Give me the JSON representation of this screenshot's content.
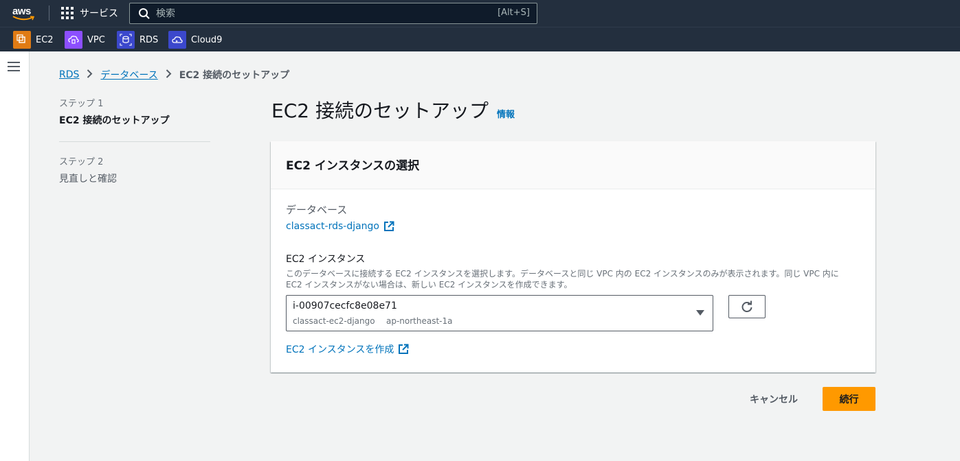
{
  "topbar": {
    "logo_text": "aws",
    "services_label": "サービス",
    "search": {
      "placeholder": "検索",
      "shortcut": "[Alt+S]"
    }
  },
  "favorites": [
    {
      "label": "EC2",
      "icon": "ec2-icon",
      "color": "#e07b14"
    },
    {
      "label": "VPC",
      "icon": "vpc-icon",
      "color": "#8c4fff"
    },
    {
      "label": "RDS",
      "icon": "rds-icon",
      "color": "#3b48cc"
    },
    {
      "label": "Cloud9",
      "icon": "cloud9-icon",
      "color": "#3b48cc"
    }
  ],
  "breadcrumb": {
    "items": [
      "RDS",
      "データベース"
    ],
    "current": "EC2 接続のセットアップ"
  },
  "steps": [
    {
      "number": "ステップ 1",
      "label": "EC2 接続のセットアップ",
      "active": true
    },
    {
      "number": "ステップ 2",
      "label": "見直しと確認",
      "active": false
    }
  ],
  "page": {
    "title": "EC2 接続のセットアップ",
    "info_link": "情報"
  },
  "card": {
    "title": "EC2 インスタンスの選択",
    "database_label": "データベース",
    "database_link": "classact-rds-django",
    "instance_label": "EC2 インスタンス",
    "instance_description": "このデータベースに接続する EC2 インスタンスを選択します。データベースと同じ VPC 内の EC2 インスタンスのみが表示されます。同じ VPC 内に EC2 インスタンスがない場合は、新しい EC2 インスタンスを作成できます。",
    "select": {
      "value": "i-00907cecfc8e08e71",
      "tag": "classact-ec2-django",
      "region": "ap-northeast-1a"
    },
    "create_link": "EC2 インスタンスを作成"
  },
  "actions": {
    "cancel": "キャンセル",
    "continue": "続行"
  },
  "colors": {
    "nav_bg": "#232f3e",
    "link": "#0073bb",
    "primary": "#ff9900"
  }
}
